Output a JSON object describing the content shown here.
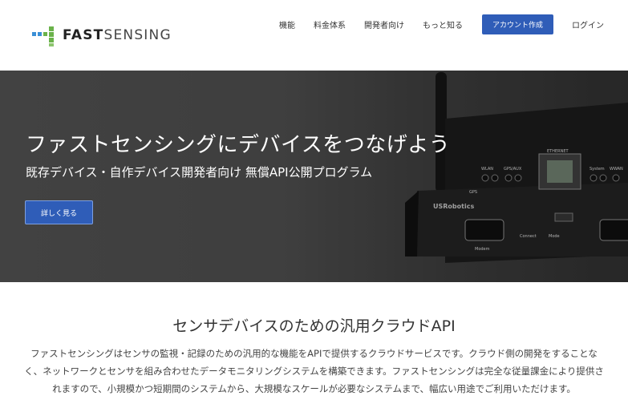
{
  "brand": {
    "name_part1": "FAST",
    "name_part2": "SENSING",
    "colors": {
      "blue": "#3a8fd6",
      "green": "#6ab24a"
    }
  },
  "nav": {
    "items": [
      "機能",
      "料金体系",
      "開発者向け",
      "もっと知る"
    ],
    "cta": "アカウント作成",
    "login": "ログイン"
  },
  "hero": {
    "title": "ファストセンシングにデバイスをつなげよう",
    "subtitle": "既存デバイス・自作デバイス開発者向け 無償API公開プログラム",
    "button": "詳しく見る",
    "device_labels": {
      "brand": "USRobotics",
      "ethernet": "ETHERNET",
      "wlan": "WLAN",
      "gps": "GPS/AUX",
      "system": "System",
      "wwan": "WWAN",
      "modem": "Modem",
      "connect": "Connect",
      "mode": "Mode",
      "gps_port": "GPS"
    }
  },
  "section": {
    "title": "センサデバイスのための汎用クラウドAPI",
    "body": "ファストセンシングはセンサの監視・記録のための汎用的な機能をAPIで提供するクラウドサービスです。クラウド側の開発をすることなく、ネットワークとセンサを組み合わせたデータモニタリングシステムを構築できます。ファストセンシングは完全な従量課金により提供されますので、小規模かつ短期間のシステムから、大規模なスケールが必要なシステムまで、幅広い用途でご利用いただけます。"
  },
  "colors": {
    "accent": "#2f5db8",
    "hero_bg": "#4a4a4a"
  }
}
